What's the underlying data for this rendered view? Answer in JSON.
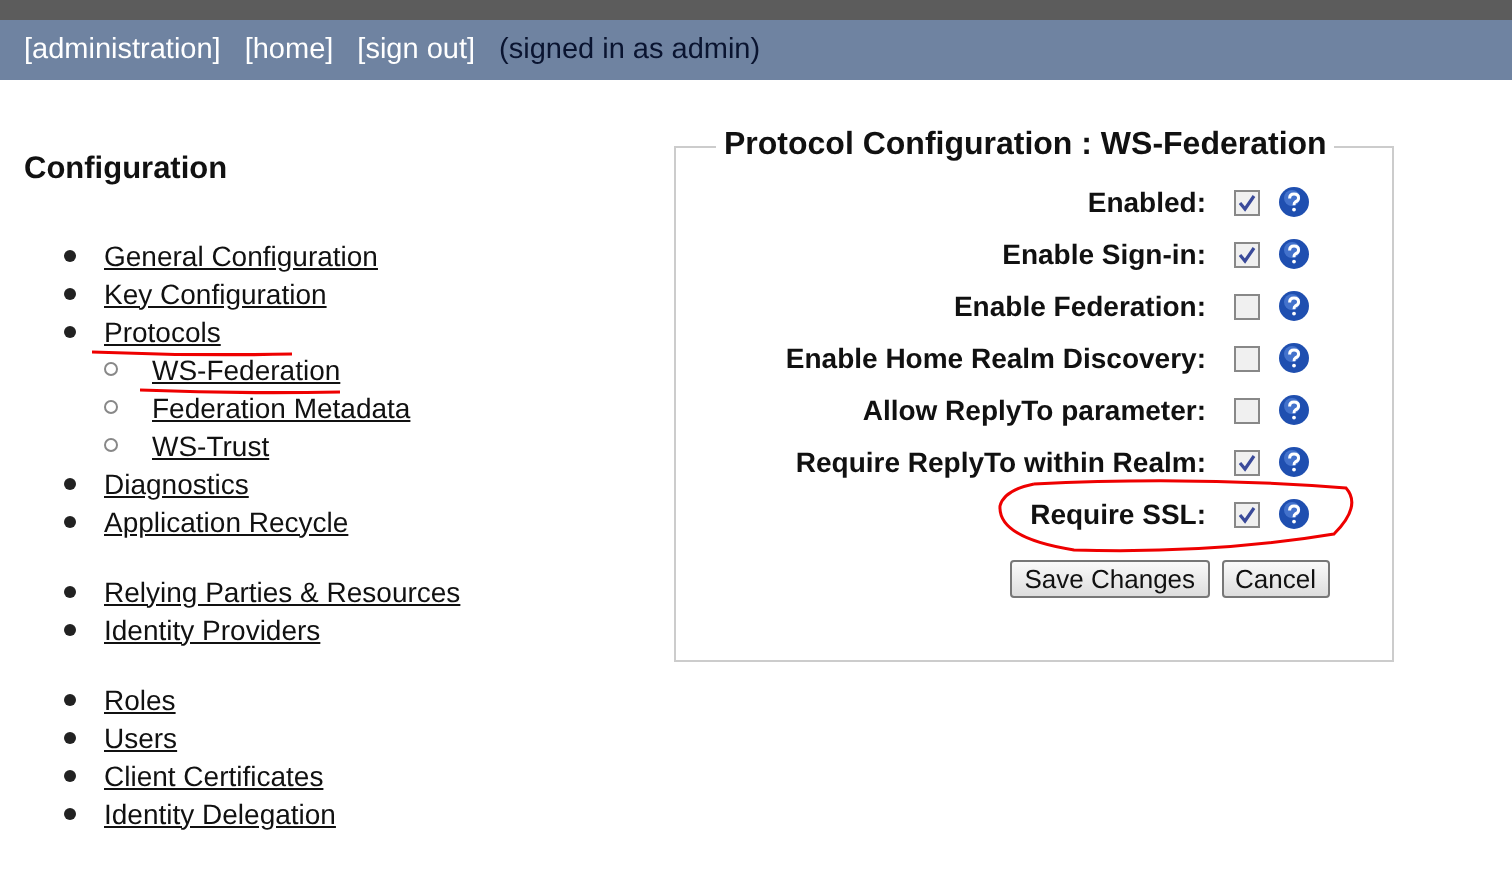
{
  "top_bar": {
    "links": [
      "[administration]",
      "[home]",
      "[sign out]"
    ],
    "status": "(signed in as admin)"
  },
  "sidebar": {
    "title": "Configuration",
    "groups": [
      {
        "items": [
          {
            "label": "General Configuration",
            "marked": false
          },
          {
            "label": "Key Configuration",
            "marked": false
          },
          {
            "label": "Protocols",
            "marked": true,
            "children": [
              {
                "label": "WS-Federation",
                "marked": true
              },
              {
                "label": "Federation Metadata",
                "marked": false
              },
              {
                "label": "WS-Trust",
                "marked": false
              }
            ]
          },
          {
            "label": "Diagnostics",
            "marked": false
          },
          {
            "label": "Application Recycle",
            "marked": false
          }
        ]
      },
      {
        "items": [
          {
            "label": "Relying Parties & Resources",
            "marked": false
          },
          {
            "label": "Identity Providers",
            "marked": false
          }
        ]
      },
      {
        "items": [
          {
            "label": "Roles",
            "marked": false
          },
          {
            "label": "Users",
            "marked": false
          },
          {
            "label": "Client Certificates",
            "marked": false
          },
          {
            "label": "Identity Delegation",
            "marked": false
          }
        ]
      }
    ]
  },
  "form": {
    "title": "Protocol Configuration : WS-Federation",
    "rows": [
      {
        "label": "Enabled:",
        "checked": true,
        "circled": false
      },
      {
        "label": "Enable Sign-in:",
        "checked": true,
        "circled": false
      },
      {
        "label": "Enable Federation:",
        "checked": false,
        "circled": false
      },
      {
        "label": "Enable Home Realm Discovery:",
        "checked": false,
        "circled": false
      },
      {
        "label": "Allow ReplyTo parameter:",
        "checked": false,
        "circled": false
      },
      {
        "label": "Require ReplyTo within Realm:",
        "checked": true,
        "circled": false
      },
      {
        "label": "Require SSL:",
        "checked": true,
        "circled": true
      }
    ],
    "buttons": [
      "Save Changes",
      "Cancel"
    ]
  }
}
